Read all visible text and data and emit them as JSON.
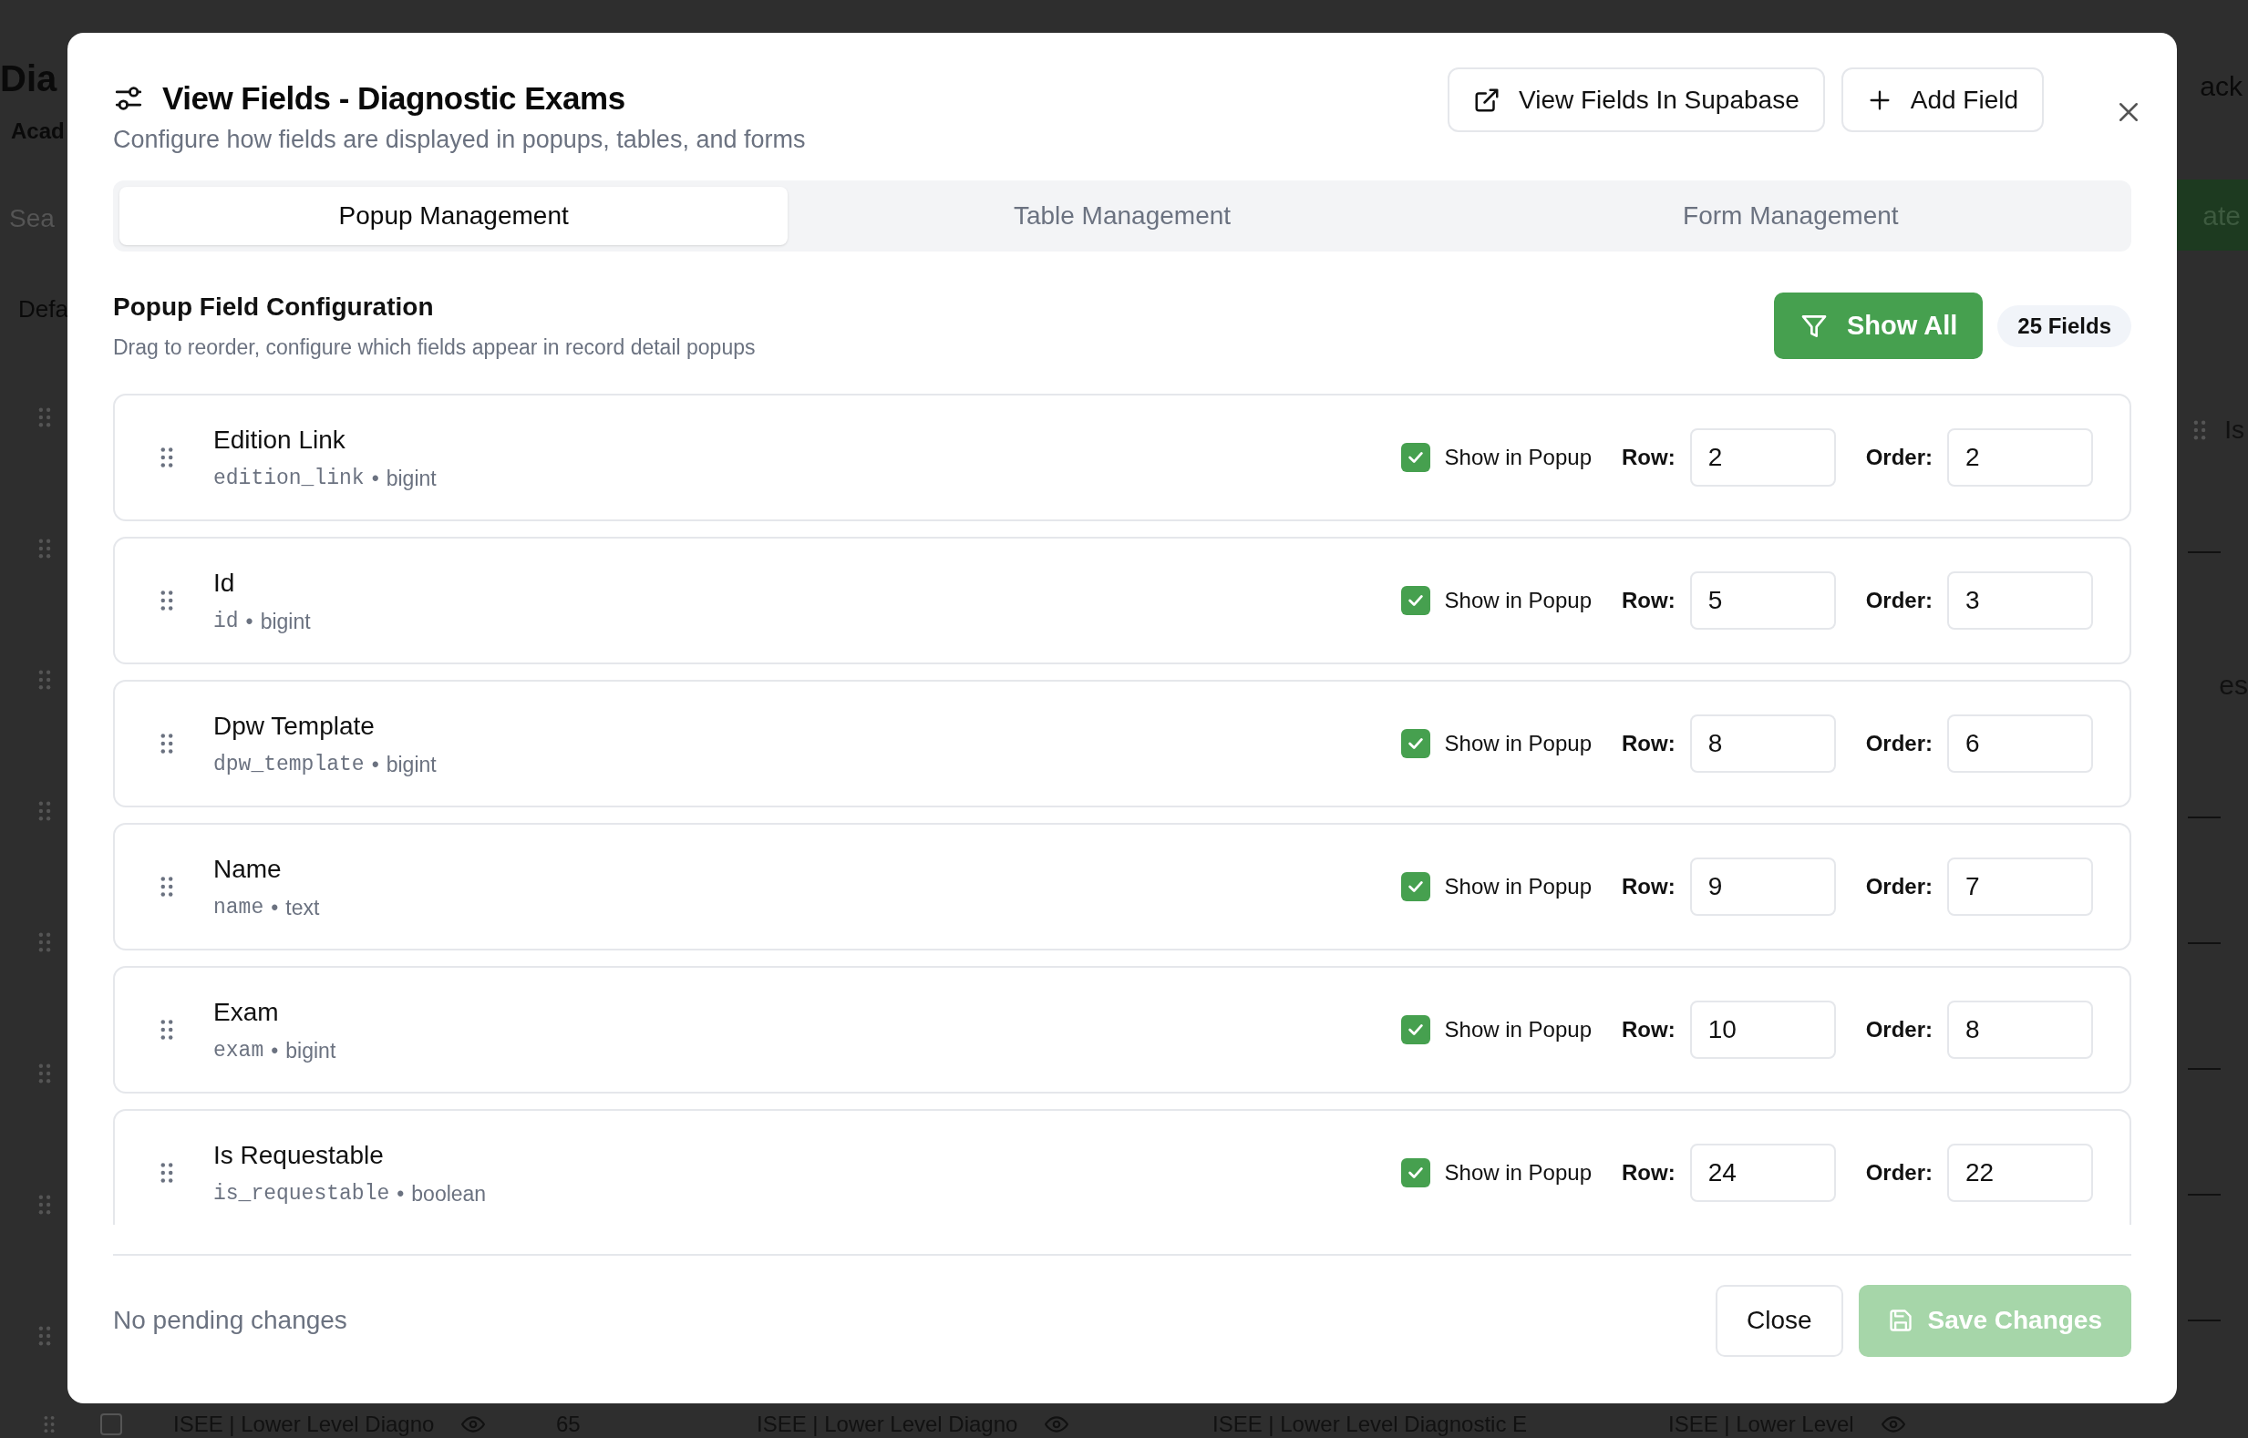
{
  "background": {
    "title": "Dia",
    "subtitle": "Acad",
    "search": {
      "placeholder": "Sea"
    },
    "label": "Defa",
    "back_link": "ack",
    "create_button": "ate",
    "column_header": "Is",
    "cell": "es",
    "row_checkbox": {
      "checked": false
    },
    "bottom_row": [
      {
        "text": "ISEE | Lower Level Diagno",
        "kind": "eye"
      },
      {
        "text": "65",
        "kind": "plain"
      },
      {
        "text": "ISEE | Lower Level Diagno",
        "kind": "eye"
      },
      {
        "text": "ISEE | Lower Level Diagnostic E",
        "kind": "plain"
      },
      {
        "text": "ISEE | Lower Level",
        "kind": "eye"
      }
    ]
  },
  "dialog": {
    "title": "View Fields - Diagnostic Exams",
    "subtitle": "Configure how fields are displayed in popups, tables, and forms",
    "buttons": [
      {
        "kind": "external",
        "label": "View Fields In Supabase"
      },
      {
        "kind": "add",
        "label": "Add Field"
      }
    ],
    "tabs": [
      {
        "label": "Popup Management",
        "selected": true
      },
      {
        "label": "Table Management",
        "selected": false
      },
      {
        "label": "Form Management",
        "selected": false
      }
    ],
    "section": {
      "title": "Popup Field Configuration",
      "subtitle": "Drag to reorder, configure which fields appear in record detail popups",
      "filter_button": "Show All",
      "count": "25 Fields"
    },
    "fields": [
      {
        "name": "Edition Link",
        "column": "edition_link",
        "separator": "•",
        "type": "bigint",
        "checked": true,
        "toggle_label": "Show in Popup",
        "row_label": "Row:",
        "row": "2",
        "order_label": "Order:",
        "order": "2"
      },
      {
        "name": "Id",
        "column": "id",
        "separator": "•",
        "type": "bigint",
        "checked": true,
        "toggle_label": "Show in Popup",
        "row_label": "Row:",
        "row": "5",
        "order_label": "Order:",
        "order": "3"
      },
      {
        "name": "Dpw Template",
        "column": "dpw_template",
        "separator": "•",
        "type": "bigint",
        "checked": true,
        "toggle_label": "Show in Popup",
        "row_label": "Row:",
        "row": "8",
        "order_label": "Order:",
        "order": "6"
      },
      {
        "name": "Name",
        "column": "name",
        "separator": "•",
        "type": "text",
        "checked": true,
        "toggle_label": "Show in Popup",
        "row_label": "Row:",
        "row": "9",
        "order_label": "Order:",
        "order": "7"
      },
      {
        "name": "Exam",
        "column": "exam",
        "separator": "•",
        "type": "bigint",
        "checked": true,
        "toggle_label": "Show in Popup",
        "row_label": "Row:",
        "row": "10",
        "order_label": "Order:",
        "order": "8"
      },
      {
        "name": "Is Requestable",
        "column": "is_requestable",
        "separator": "•",
        "type": "boolean",
        "checked": true,
        "toggle_label": "Show in Popup",
        "row_label": "Row:",
        "row": "24",
        "order_label": "Order:",
        "order": "22"
      }
    ],
    "footer": {
      "status": "No pending changes",
      "close": "Close",
      "save": {
        "label": "Save Changes",
        "disabled": true
      }
    }
  }
}
